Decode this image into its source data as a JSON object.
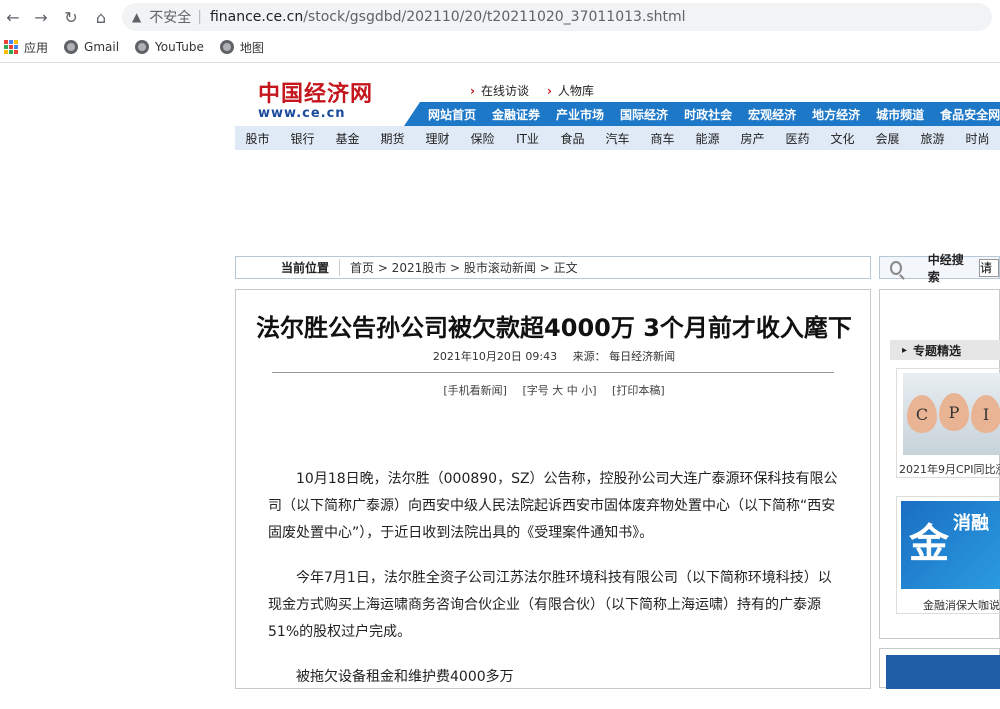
{
  "browser": {
    "url_host": "finance.ce.cn",
    "url_path": "/stock/gsgdbd/202110/20/t20211020_37011013.shtml",
    "security_label": "不安全",
    "bookmarks": [
      {
        "label": "应用",
        "icon": "apps-icon"
      },
      {
        "label": "Gmail",
        "icon": "globe-icon"
      },
      {
        "label": "YouTube",
        "icon": "globe-icon"
      },
      {
        "label": "地图",
        "icon": "globe-icon"
      }
    ]
  },
  "site": {
    "logo_cn": "中国经济网",
    "logo_url": "www.ce.cn",
    "top_links": [
      "在线访谈",
      "人物库"
    ],
    "nav_primary": [
      "网站首页",
      "金融证券",
      "产业市场",
      "国际经济",
      "时政社会",
      "宏观经济",
      "地方经济",
      "城市频道",
      "食品安全网"
    ],
    "nav_secondary": [
      "股市",
      "银行",
      "基金",
      "期货",
      "理财",
      "保险",
      "IT业",
      "食品",
      "汽车",
      "商车",
      "能源",
      "房产",
      "医药",
      "文化",
      "会展",
      "旅游",
      "时尚"
    ]
  },
  "breadcrumb": {
    "label": "当前位置",
    "path": "首页 > 2021股市 > 股市滚动新闻 > 正文"
  },
  "search": {
    "label": "中经搜索",
    "value": "请"
  },
  "article": {
    "title": "法尔胜公告孙公司被欠款超4000万 3个月前才收入麾下",
    "date": "2021年10月20日 09:43",
    "source": "来源： 每日经济新闻",
    "tools": [
      "[手机看新闻]",
      "[字号 大 中 小]",
      "[打印本稿]"
    ],
    "paragraphs": [
      "10月18日晚，法尔胜（000890，SZ）公告称，控股孙公司大连广泰源环保科技有限公司（以下简称广泰源）向西安中级人民法院起诉西安市固体废弃物处置中心（以下简称“西安固废处置中心”），于近日收到法院出具的《受理案件通知书》。",
      "今年7月1日，法尔胜全资子公司江苏法尔胜环境科技有限公司（以下简称环境科技）以现金方式购买上海运啸商务咨询合伙企业（有限合伙）（以下简称上海运啸）持有的广泰源51%的股权过户完成。",
      "被拖欠设备租金和维护费4000多万"
    ]
  },
  "sidebar": {
    "heading": "专题精选",
    "card1_caption": "2021年9月CPI同比涨",
    "card1_eggs": [
      "C",
      "P",
      "I"
    ],
    "card2_big": "金",
    "card2_small": "消融",
    "card2_caption": "金融消保大咖说"
  }
}
